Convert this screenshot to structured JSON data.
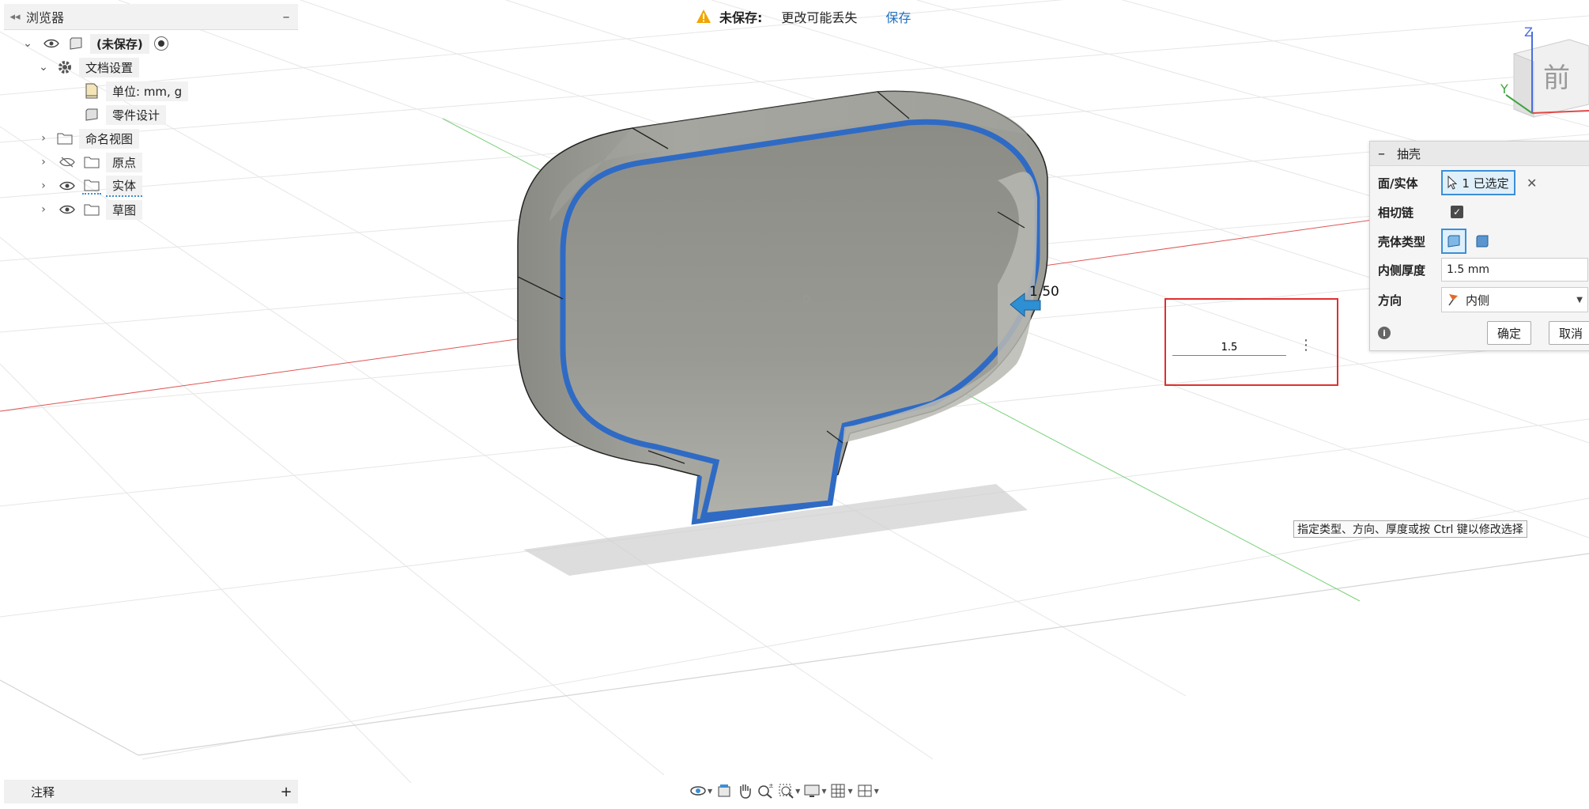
{
  "browser": {
    "title": "浏览器",
    "root_label": "(未保存)",
    "items": [
      {
        "label": "文档设置"
      },
      {
        "label": "单位: mm, g"
      },
      {
        "label": "零件设计"
      },
      {
        "label": "命名视图"
      },
      {
        "label": "原点"
      },
      {
        "label": "实体"
      },
      {
        "label": "草图"
      }
    ]
  },
  "unsaved": {
    "title": "未保存:",
    "message": "更改可能丢失",
    "save_label": "保存"
  },
  "viewcube": {
    "face_label": "前",
    "z_label": "Z",
    "y_label": "Y"
  },
  "dimension_label": "1.50",
  "shell": {
    "title": "抽壳",
    "face_body_label": "面/实体",
    "selection_label": "1 已选定",
    "tangent_chain_label": "相切链",
    "tangent_chain_checked": true,
    "shell_type_label": "壳体类型",
    "inside_thickness_label": "内侧厚度",
    "inside_thickness_value": "1.5 mm",
    "direction_label": "方向",
    "direction_value": "内侧",
    "ok_label": "确定",
    "cancel_label": "取消"
  },
  "value_input": "1.5",
  "tooltip": "指定类型、方向、厚度或按 Ctrl 键以修改选择",
  "annotations_label": "注释",
  "colors": {
    "accent": "#3c8fd6",
    "highlight_edge": "#2f6bc4",
    "warning": "#f0a500",
    "red_box": "#e03030"
  }
}
